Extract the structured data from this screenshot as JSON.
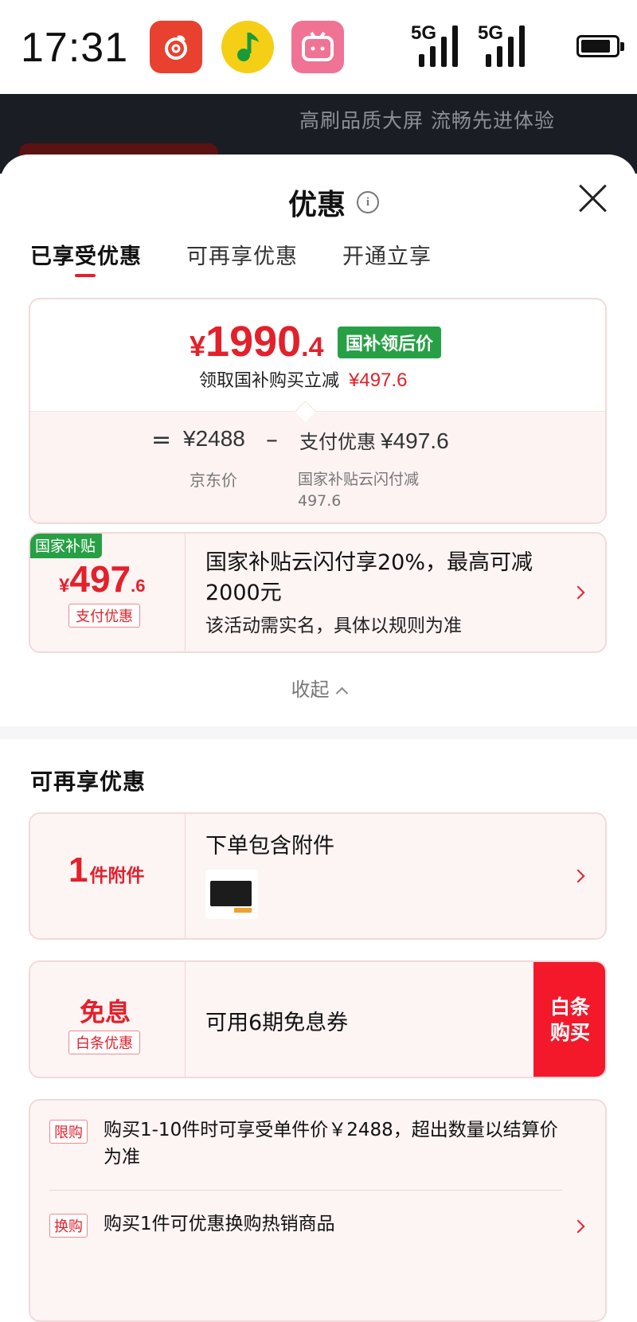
{
  "status_bar": {
    "time": "17:31",
    "apps": [
      "netease-music-icon",
      "qq-music-icon",
      "bilibili-icon"
    ],
    "signal1": "5G",
    "signal2": "5G",
    "battery_level": 0.85
  },
  "background_page": {
    "promo_text": "高刷品质大屏 流畅先进体验"
  },
  "sheet": {
    "title": "优惠",
    "tabs": [
      {
        "label": "已享受优惠",
        "active": true
      },
      {
        "label": "可再享优惠",
        "active": false
      },
      {
        "label": "开通立享",
        "active": false
      }
    ]
  },
  "price_card": {
    "final_price_yen": "¥",
    "final_price_int": "1990",
    "final_price_dec": ".4",
    "tag": "国补领后价",
    "subline": "领取国补购买立减",
    "subline_amount": "¥497.6",
    "eq": "=",
    "jd_price": "¥2488",
    "jd_label": "京东价",
    "minus": "–",
    "pay_label": "支付优惠",
    "pay_amount": "¥497.6",
    "pay_desc": "国家补贴云闪付减497.6"
  },
  "subsidy_card": {
    "corner_tag": "国家补贴",
    "amount_yen": "¥",
    "amount_int": "497",
    "amount_dec": ".6",
    "amount_tag": "支付优惠",
    "title": "国家补贴云闪付享20%，最高可减2000元",
    "note": "该活动需实名，具体以规则为准"
  },
  "collapse_label": "收起",
  "section2_title": "可再享优惠",
  "accessory_card": {
    "count": "1",
    "unit": "件附件",
    "title": "下单包含附件"
  },
  "interest_card": {
    "label": "免息",
    "tag": "白条优惠",
    "title": "可用6期免息券",
    "button_line1": "白条",
    "button_line2": "购买"
  },
  "limit_card": {
    "row1_tag": "限购",
    "row1_text": "购买1-10件时可享受单件价￥2488，超出数量以结算价为准",
    "row2_tag": "换购",
    "row2_text": "购买1件可优惠换购热销商品"
  }
}
